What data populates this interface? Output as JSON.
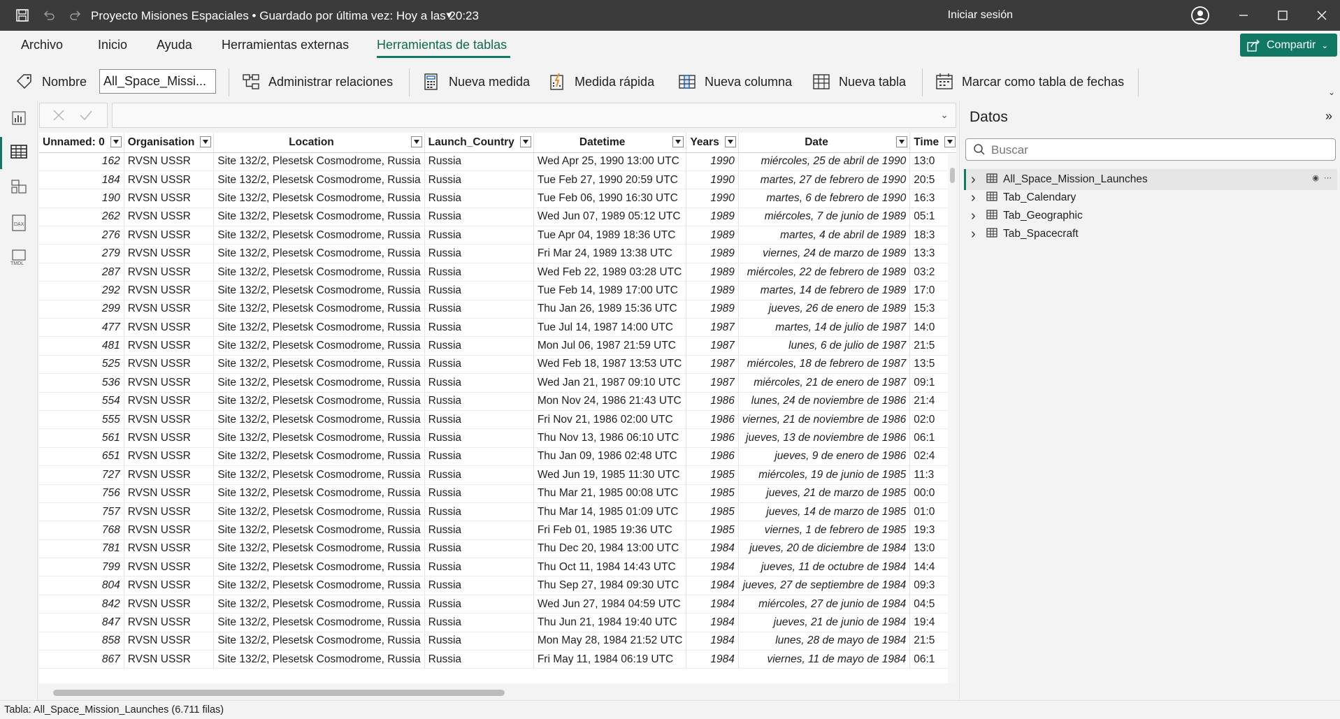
{
  "titlebar": {
    "title": "Proyecto Misiones Espaciales • Guardado por última vez: Hoy a las 20:23",
    "signin": "Iniciar sesión"
  },
  "menu": {
    "tabs": [
      "Archivo",
      "Inicio",
      "Ayuda",
      "Herramientas externas",
      "Herramientas de tablas"
    ],
    "active": "Herramientas de tablas",
    "share_label": "Compartir"
  },
  "ribbon": {
    "name_label": "Nombre",
    "name_value": "All_Space_Missi...",
    "manage_relations": "Administrar relaciones",
    "new_measure": "Nueva medida",
    "quick_measure": "Medida rápida",
    "new_column": "Nueva columna",
    "new_table": "Nueva tabla",
    "mark_date_table": "Marcar como tabla de fechas"
  },
  "grid": {
    "columns": [
      "Unnamed: 0",
      "Organisation",
      "Location",
      "Launch_Country",
      "Datetime",
      "Years",
      "Date",
      "Time"
    ],
    "rows": [
      [
        "162",
        "RVSN USSR",
        "Site 132/2, Plesetsk Cosmodrome, Russia",
        "Russia",
        "Wed Apr 25, 1990 13:00 UTC",
        "1990",
        "miércoles, 25 de abril de 1990",
        "13:0"
      ],
      [
        "184",
        "RVSN USSR",
        "Site 132/2, Plesetsk Cosmodrome, Russia",
        "Russia",
        "Tue Feb 27, 1990 20:59 UTC",
        "1990",
        "martes, 27 de febrero de 1990",
        "20:5"
      ],
      [
        "190",
        "RVSN USSR",
        "Site 132/2, Plesetsk Cosmodrome, Russia",
        "Russia",
        "Tue Feb 06, 1990 16:30 UTC",
        "1990",
        "martes, 6 de febrero de 1990",
        "16:3"
      ],
      [
        "262",
        "RVSN USSR",
        "Site 132/2, Plesetsk Cosmodrome, Russia",
        "Russia",
        "Wed Jun 07, 1989 05:12 UTC",
        "1989",
        "miércoles, 7 de junio de 1989",
        "05:1"
      ],
      [
        "276",
        "RVSN USSR",
        "Site 132/2, Plesetsk Cosmodrome, Russia",
        "Russia",
        "Tue Apr 04, 1989 18:36 UTC",
        "1989",
        "martes, 4 de abril de 1989",
        "18:3"
      ],
      [
        "279",
        "RVSN USSR",
        "Site 132/2, Plesetsk Cosmodrome, Russia",
        "Russia",
        "Fri Mar 24, 1989 13:38 UTC",
        "1989",
        "viernes, 24 de marzo de 1989",
        "13:3"
      ],
      [
        "287",
        "RVSN USSR",
        "Site 132/2, Plesetsk Cosmodrome, Russia",
        "Russia",
        "Wed Feb 22, 1989 03:28 UTC",
        "1989",
        "miércoles, 22 de febrero de 1989",
        "03:2"
      ],
      [
        "292",
        "RVSN USSR",
        "Site 132/2, Plesetsk Cosmodrome, Russia",
        "Russia",
        "Tue Feb 14, 1989 17:00 UTC",
        "1989",
        "martes, 14 de febrero de 1989",
        "17:0"
      ],
      [
        "299",
        "RVSN USSR",
        "Site 132/2, Plesetsk Cosmodrome, Russia",
        "Russia",
        "Thu Jan 26, 1989 15:36 UTC",
        "1989",
        "jueves, 26 de enero de 1989",
        "15:3"
      ],
      [
        "477",
        "RVSN USSR",
        "Site 132/2, Plesetsk Cosmodrome, Russia",
        "Russia",
        "Tue Jul 14, 1987 14:00 UTC",
        "1987",
        "martes, 14 de julio de 1987",
        "14:0"
      ],
      [
        "481",
        "RVSN USSR",
        "Site 132/2, Plesetsk Cosmodrome, Russia",
        "Russia",
        "Mon Jul 06, 1987 21:59 UTC",
        "1987",
        "lunes, 6 de julio de 1987",
        "21:5"
      ],
      [
        "525",
        "RVSN USSR",
        "Site 132/2, Plesetsk Cosmodrome, Russia",
        "Russia",
        "Wed Feb 18, 1987 13:53 UTC",
        "1987",
        "miércoles, 18 de febrero de 1987",
        "13:5"
      ],
      [
        "536",
        "RVSN USSR",
        "Site 132/2, Plesetsk Cosmodrome, Russia",
        "Russia",
        "Wed Jan 21, 1987 09:10 UTC",
        "1987",
        "miércoles, 21 de enero de 1987",
        "09:1"
      ],
      [
        "554",
        "RVSN USSR",
        "Site 132/2, Plesetsk Cosmodrome, Russia",
        "Russia",
        "Mon Nov 24, 1986 21:43 UTC",
        "1986",
        "lunes, 24 de noviembre de 1986",
        "21:4"
      ],
      [
        "555",
        "RVSN USSR",
        "Site 132/2, Plesetsk Cosmodrome, Russia",
        "Russia",
        "Fri Nov 21, 1986 02:00 UTC",
        "1986",
        "viernes, 21 de noviembre de 1986",
        "02:0"
      ],
      [
        "561",
        "RVSN USSR",
        "Site 132/2, Plesetsk Cosmodrome, Russia",
        "Russia",
        "Thu Nov 13, 1986 06:10 UTC",
        "1986",
        "jueves, 13 de noviembre de 1986",
        "06:1"
      ],
      [
        "651",
        "RVSN USSR",
        "Site 132/2, Plesetsk Cosmodrome, Russia",
        "Russia",
        "Thu Jan 09, 1986 02:48 UTC",
        "1986",
        "jueves, 9 de enero de 1986",
        "02:4"
      ],
      [
        "727",
        "RVSN USSR",
        "Site 132/2, Plesetsk Cosmodrome, Russia",
        "Russia",
        "Wed Jun 19, 1985 11:30 UTC",
        "1985",
        "miércoles, 19 de junio de 1985",
        "11:3"
      ],
      [
        "756",
        "RVSN USSR",
        "Site 132/2, Plesetsk Cosmodrome, Russia",
        "Russia",
        "Thu Mar 21, 1985 00:08 UTC",
        "1985",
        "jueves, 21 de marzo de 1985",
        "00:0"
      ],
      [
        "757",
        "RVSN USSR",
        "Site 132/2, Plesetsk Cosmodrome, Russia",
        "Russia",
        "Thu Mar 14, 1985 01:09 UTC",
        "1985",
        "jueves, 14 de marzo de 1985",
        "01:0"
      ],
      [
        "768",
        "RVSN USSR",
        "Site 132/2, Plesetsk Cosmodrome, Russia",
        "Russia",
        "Fri Feb 01, 1985 19:36 UTC",
        "1985",
        "viernes, 1 de febrero de 1985",
        "19:3"
      ],
      [
        "781",
        "RVSN USSR",
        "Site 132/2, Plesetsk Cosmodrome, Russia",
        "Russia",
        "Thu Dec 20, 1984 13:00 UTC",
        "1984",
        "jueves, 20 de diciembre de 1984",
        "13:0"
      ],
      [
        "799",
        "RVSN USSR",
        "Site 132/2, Plesetsk Cosmodrome, Russia",
        "Russia",
        "Thu Oct 11, 1984 14:43 UTC",
        "1984",
        "jueves, 11 de octubre de 1984",
        "14:4"
      ],
      [
        "804",
        "RVSN USSR",
        "Site 132/2, Plesetsk Cosmodrome, Russia",
        "Russia",
        "Thu Sep 27, 1984 09:30 UTC",
        "1984",
        "jueves, 27 de septiembre de 1984",
        "09:3"
      ],
      [
        "842",
        "RVSN USSR",
        "Site 132/2, Plesetsk Cosmodrome, Russia",
        "Russia",
        "Wed Jun 27, 1984 04:59 UTC",
        "1984",
        "miércoles, 27 de junio de 1984",
        "04:5"
      ],
      [
        "847",
        "RVSN USSR",
        "Site 132/2, Plesetsk Cosmodrome, Russia",
        "Russia",
        "Thu Jun 21, 1984 19:40 UTC",
        "1984",
        "jueves, 21 de junio de 1984",
        "19:4"
      ],
      [
        "858",
        "RVSN USSR",
        "Site 132/2, Plesetsk Cosmodrome, Russia",
        "Russia",
        "Mon May 28, 1984 21:52 UTC",
        "1984",
        "lunes, 28 de mayo de 1984",
        "21:5"
      ],
      [
        "867",
        "RVSN USSR",
        "Site 132/2, Plesetsk Cosmodrome, Russia",
        "Russia",
        "Fri May 11, 1984 06:19 UTC",
        "1984",
        "viernes, 11 de mayo de 1984",
        "06:1"
      ]
    ]
  },
  "datapanel": {
    "title": "Datos",
    "search_placeholder": "Buscar",
    "tables": [
      "All_Space_Mission_Launches",
      "Tab_Calendary",
      "Tab_Geographic",
      "Tab_Spacecraft"
    ],
    "selected": "All_Space_Mission_Launches"
  },
  "statusbar": {
    "text": "Tabla: All_Space_Mission_Launches (6.711 filas)"
  },
  "colors": {
    "accent": "#117865",
    "titlebar": "#3b3b3b"
  },
  "icons": [
    "save-icon",
    "undo-icon",
    "redo-icon",
    "account-icon",
    "minimize-icon",
    "maximize-icon",
    "close-icon",
    "share-icon",
    "tag-icon",
    "relations-icon",
    "measure-icon",
    "quick-measure-icon",
    "column-icon",
    "table-icon",
    "date-table-icon",
    "report-view-icon",
    "table-view-icon",
    "model-view-icon",
    "dax-view-icon",
    "tmdl-view-icon",
    "search-icon",
    "expand-pane-icon"
  ]
}
